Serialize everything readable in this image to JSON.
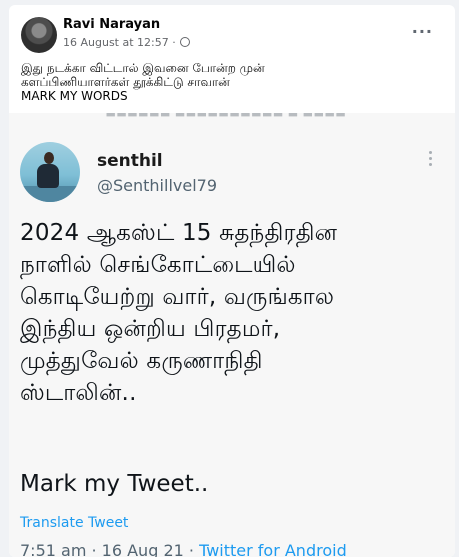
{
  "post": {
    "author": "Ravi Narayan",
    "date": "16 August at 12:57",
    "separator": "·",
    "privacy_icon": "globe-icon",
    "more_icon": "more-options-icon",
    "more_glyph": "···",
    "caption": "இது நடக்கா விட்டால் இவனை போன்ற முன்\nகளப்பிணியாளர்கள் தூக்கிட்டு சாவான்\nMARK MY  WORDS"
  },
  "tweet": {
    "cutoff_text": "—■■■■■■ ■■■■■■■■■■ ■ ■■■■",
    "name": "senthil",
    "handle": "@Senthillvel79",
    "body": "2024 ஆகஸ்ட் 15 சுதந்திரதின\nநாளில்  செங்கோட்டையில்\nகொடியேற்று வார், வருங்கால\nஇந்திய ஒன்றிய பிரதமர்,\nமுத்துவேல் கருணாநிதி\nஸ்டாலின்..",
    "closing": "Mark my Tweet..",
    "translate": "Translate Tweet",
    "time": "7:51 am · 16 Aug 21 · ",
    "source": "Twitter for Android"
  }
}
